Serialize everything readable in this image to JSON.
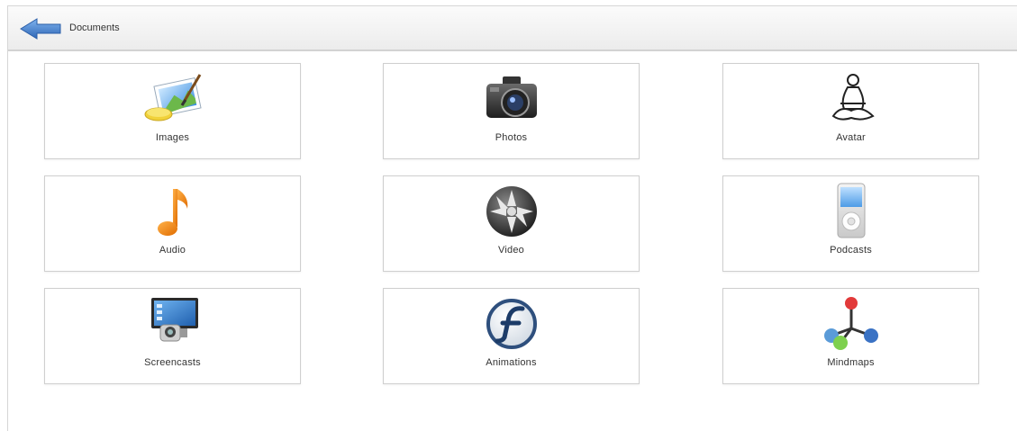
{
  "header": {
    "back_icon": "back-arrow-icon",
    "title": "Documents"
  },
  "tiles": [
    {
      "label": "Images",
      "icon": "images-icon"
    },
    {
      "label": "Photos",
      "icon": "camera-icon"
    },
    {
      "label": "Avatar",
      "icon": "avatar-icon"
    },
    {
      "label": "Audio",
      "icon": "music-note-icon"
    },
    {
      "label": "Video",
      "icon": "film-reel-icon"
    },
    {
      "label": "Podcasts",
      "icon": "media-player-icon"
    },
    {
      "label": "Screencasts",
      "icon": "screencast-icon"
    },
    {
      "label": "Animations",
      "icon": "flash-icon"
    },
    {
      "label": "Mindmaps",
      "icon": "mindmap-icon"
    }
  ],
  "colors": {
    "accent": "#3d7fd0",
    "music": "#f08a1c",
    "text": "#333333"
  }
}
